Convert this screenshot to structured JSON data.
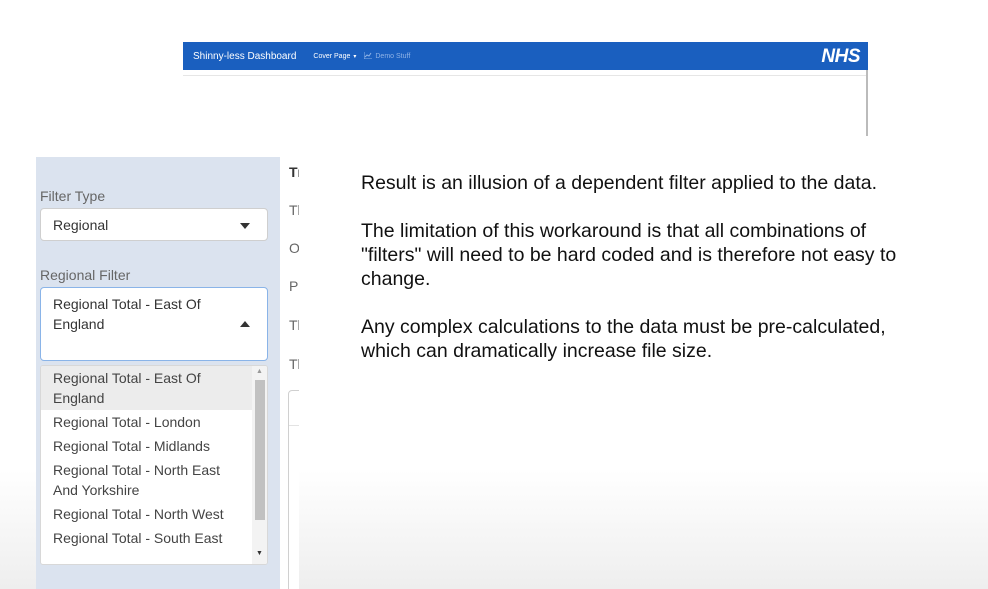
{
  "navbar": {
    "brand": "Shinny-less Dashboard",
    "menu_cover": "Cover Page",
    "menu_caret": "▾",
    "menu_demo": "Demo Stuff",
    "chart_icon": "chart-line-icon",
    "logo": "NHS",
    "bg_color": "#1a5fbf"
  },
  "sidebar": {
    "filter_type_label": "Filter Type",
    "filter_type_value": "Regional",
    "regional_filter_label": "Regional Filter",
    "regional_filter_value_line1": "Regional Total - East Of",
    "regional_filter_value_line2": "England",
    "options": [
      [
        "Regional Total - East Of",
        "England"
      ],
      [
        "Regional Total - London"
      ],
      [
        "Regional Total - Midlands"
      ],
      [
        "Regional Total - North East",
        "And Yorkshire"
      ],
      [
        "Regional Total - North West"
      ],
      [
        "Regional Total - South East"
      ]
    ],
    "bg_color": "#dbe3ef"
  },
  "middle_fragments": [
    "Tı",
    "Tl",
    "O",
    "P",
    "Tl",
    "Tl"
  ],
  "explanation": {
    "p1": "Result is an illusion of a dependent filter applied to the data.",
    "p2": "The limitation of this workaround is that all combinations of \"filters\" will need to be hard coded and is therefore not easy to change.",
    "p3": "Any complex calculations to the data must be pre-calculated, which can dramatically increase file size."
  }
}
